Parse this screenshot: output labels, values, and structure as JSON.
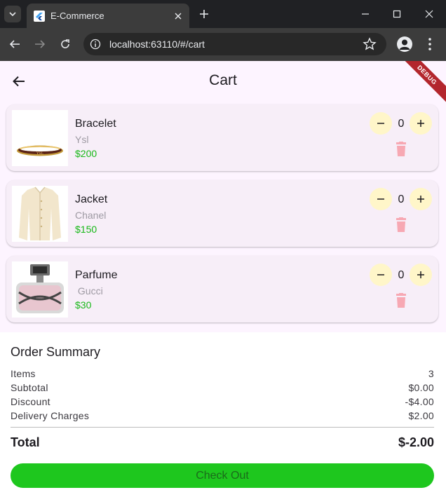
{
  "browser": {
    "tab_title": "E-Commerce",
    "url": "localhost:63110/#/cart"
  },
  "app": {
    "title": "Cart",
    "debug_label": "DEBUG"
  },
  "cart": {
    "items": [
      {
        "name": "Bracelet",
        "brand": "Ysl",
        "price": "$200",
        "quantity": "0",
        "thumb": "bracelet"
      },
      {
        "name": "Jacket",
        "brand": "Chanel",
        "price": "$150",
        "quantity": "0",
        "thumb": "jacket"
      },
      {
        "name": "Parfume",
        "brand": " Gucci",
        "price": "$30",
        "quantity": "0",
        "thumb": "perfume"
      }
    ]
  },
  "summary": {
    "title": "Order Summary",
    "items_label": "Items",
    "items_value": "3",
    "subtotal_label": "Subtotal",
    "subtotal_value": "$0.00",
    "discount_label": "Discount",
    "discount_value": "-$4.00",
    "delivery_label": "Delivery Charges",
    "delivery_value": "$2.00",
    "total_label": "Total",
    "total_value": "$-2.00",
    "checkout_label": "Check Out"
  },
  "colors": {
    "price": "#18b818",
    "qty_button": "#fff6c9",
    "trash": "#f7a8b3",
    "checkout": "#1ec71e",
    "cart_background": "#fdf4ff"
  },
  "icons": [
    "tab-search-icon",
    "flutter-favicon-icon",
    "close-icon",
    "new-tab-icon",
    "minimize-icon",
    "maximize-icon",
    "window-close-icon",
    "back-arrow-icon",
    "forward-arrow-icon",
    "reload-icon",
    "site-info-icon",
    "bookmark-star-icon",
    "profile-icon",
    "more-menu-icon",
    "app-back-arrow-icon",
    "minus-icon",
    "plus-icon",
    "trash-icon"
  ]
}
